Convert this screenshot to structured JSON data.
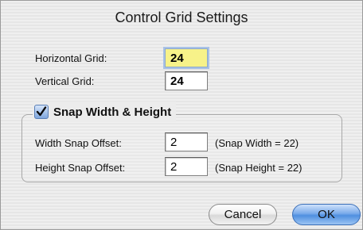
{
  "window": {
    "title": "Control Grid Settings"
  },
  "grid": {
    "horizontal_label": "Horizontal Grid:",
    "horizontal_value": "24",
    "vertical_label": "Vertical Grid:",
    "vertical_value": "24"
  },
  "snap": {
    "checkbox_label": "Snap Width & Height",
    "checked": true,
    "width_offset_label": "Width Snap Offset:",
    "width_offset_value": "2",
    "width_hint": "(Snap Width = 22)",
    "height_offset_label": "Height Snap Offset:",
    "height_offset_value": "2",
    "height_hint": "(Snap Height = 22)"
  },
  "buttons": {
    "cancel_label": "Cancel",
    "ok_label": "OK"
  },
  "colors": {
    "focused_field_bg": "#f7f289",
    "default_button": "#4f8fe0"
  }
}
